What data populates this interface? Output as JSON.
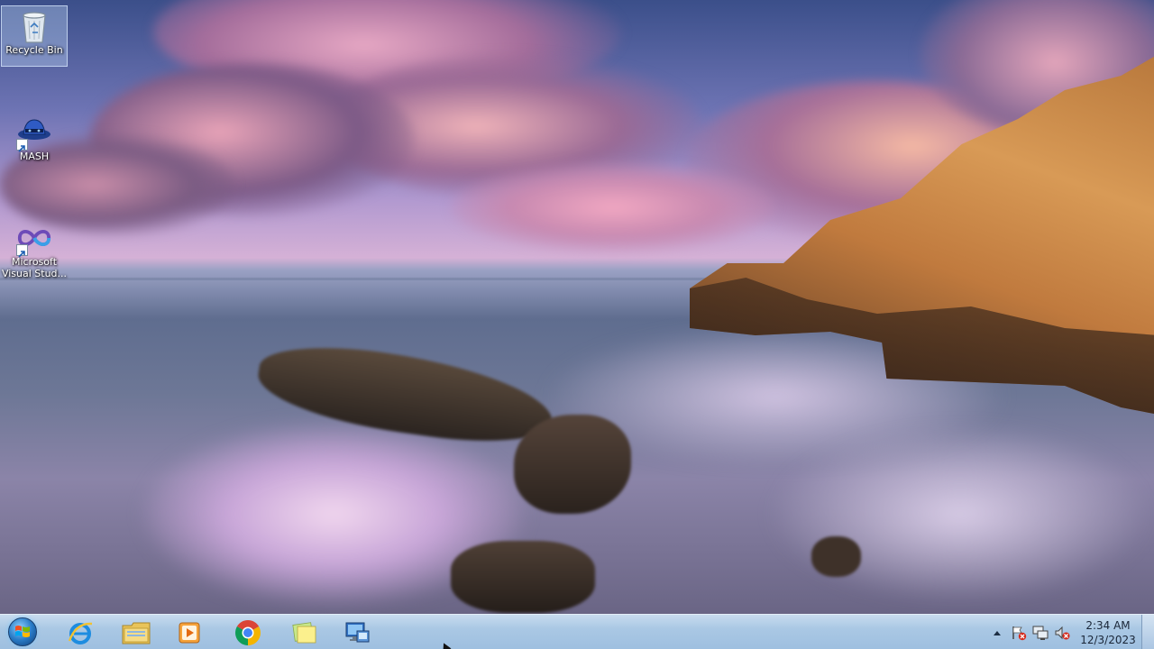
{
  "desktop": {
    "icons": [
      {
        "label": "Recycle Bin",
        "icon": "recycle-bin-icon"
      },
      {
        "label": "MASH",
        "icon": "mash-icon"
      },
      {
        "label": "Microsoft Visual Stud...",
        "icon": "visual-studio-icon"
      }
    ]
  },
  "taskbar": {
    "start_icon": "windows-start-orb",
    "pinned": [
      {
        "name": "Internet Explorer",
        "icon": "internet-explorer-icon"
      },
      {
        "name": "File Explorer",
        "icon": "file-explorer-icon"
      },
      {
        "name": "Media Player",
        "icon": "media-player-icon"
      },
      {
        "name": "Google Chrome",
        "icon": "chrome-icon"
      },
      {
        "name": "Sticky Notes",
        "icon": "sticky-notes-icon"
      },
      {
        "name": "Remote Desktop",
        "icon": "remote-desktop-icon"
      }
    ],
    "tray": {
      "icons": [
        "show-hidden-icons-arrow",
        "action-center-flag-icon",
        "network-icon",
        "volume-muted-icon"
      ],
      "time": "2:34 AM",
      "date": "12/3/2023"
    }
  },
  "colors": {
    "taskbar": "#aac8e4",
    "accent_blue": "#2a7cc7"
  }
}
